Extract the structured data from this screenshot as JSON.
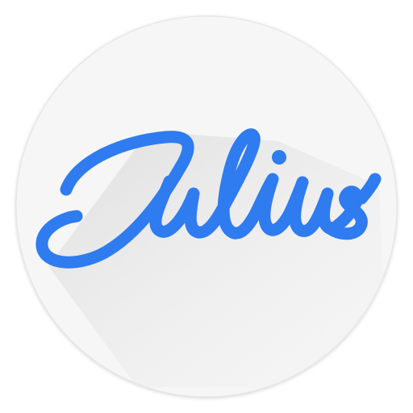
{
  "icon": {
    "wordmark": "Julius",
    "name": "julius-app-icon",
    "colors": {
      "background": "#ffffff",
      "circle": "#f6f6f6",
      "circle_edge": "#e4e4e4",
      "long_shadow": "#e6e6e6",
      "lettering": "#2f7bf0"
    }
  }
}
